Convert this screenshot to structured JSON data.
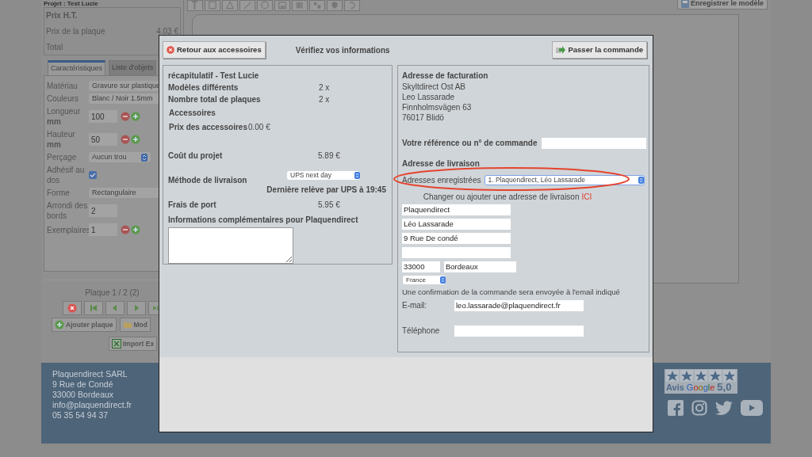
{
  "background": {
    "project_title": "Projet : Test Lucie",
    "save_button": "Enregistrer le modèle",
    "price": {
      "title": "Prix H.T.",
      "rows": [
        {
          "label": "Prix de la plaque",
          "value": "4.03 €"
        },
        {
          "label": "Total"
        }
      ]
    },
    "tabs": [
      {
        "label": "Caractéristiques",
        "selected": true
      },
      {
        "label": "Liste d'objets",
        "selected": false
      }
    ],
    "form": [
      {
        "label": "Matériau",
        "kind": "choice",
        "value": "Gravure sur plastique"
      },
      {
        "label": "Couleurs",
        "kind": "choice",
        "value": "Blanc / Noir 1.5mm"
      },
      {
        "label": "Longueur",
        "unit": "mm",
        "kind": "number",
        "value": "100",
        "stepper": true
      },
      {
        "label": "Hauteur",
        "unit": "mm",
        "kind": "number",
        "value": "50",
        "stepper": true
      },
      {
        "label": "Perçage",
        "kind": "dropdown",
        "value": "Aucun trou"
      },
      {
        "label": "Adhésif au dos",
        "kind": "checkbox",
        "checked": true
      },
      {
        "label": "Forme",
        "kind": "choice",
        "value": "Rectangulaire"
      },
      {
        "label": "Arrondi des bords",
        "kind": "number",
        "value": "2",
        "stepper": false
      },
      {
        "label": "Exemplaires",
        "kind": "number",
        "value": "1",
        "stepper": true
      }
    ],
    "pager": "Plaque 1 / 2 (2)",
    "actions": [
      {
        "label": "Ajouter plaque",
        "kind": "add"
      },
      {
        "label": "Mod",
        "kind": "folder"
      },
      {
        "label": "Import Ex",
        "kind": "excel"
      }
    ],
    "footer": [
      "Plaquendirect SARL",
      "9 Rue de Condé",
      "33000 Bordeaux",
      "info@plaquendirect.fr",
      "05 35 54 94 37"
    ],
    "rating": {
      "stars": 5,
      "label": "Avis",
      "brand": "Google",
      "score": "5,0"
    }
  },
  "modal": {
    "back_button": "Retour aux accessoires",
    "title": "Vérifiez vos informations",
    "submit_button": "Passer la commande",
    "summary": {
      "title": "récapitulatif - Test Lucie",
      "rows": [
        {
          "label": "Modèles différents",
          "value": "2 x"
        },
        {
          "label": "Nombre total de plaques",
          "value": "2 x"
        }
      ],
      "accessories_title": "Accessoires",
      "accessories_label": "Prix des accessoires",
      "accessories_value": "0.00 €",
      "cost_label": "Coût du projet",
      "cost_value": "5.89 €",
      "delivery_label": "Méthode de livraison",
      "delivery_value": "UPS next day",
      "pickup_note": "Dernière relève par UPS à 19:45",
      "shipping_label": "Frais de port",
      "shipping_value": "5.95 €",
      "info_label": "Informations complémentaires pour Plaquendirect"
    },
    "billing": {
      "title": "Adresse de facturation",
      "lines": [
        "Skyltdirect Ost AB",
        "Leo Lassarade",
        "Finnholmsvägen 63",
        "76017 Blidö"
      ],
      "reference_label": "Votre référence ou n° de commande"
    },
    "shipping": {
      "title": "Adresse de livraison",
      "saved_label": "Adresses enregistrées",
      "saved_value": "1. Plaquendirect, Léo Lassarade",
      "change_text": "Changer ou ajouter une adresse de livraison",
      "change_link": "ICI",
      "fields": [
        "Plaquendirect",
        "Léo Lassarade",
        "9 Rue De condé"
      ],
      "zip": "33000",
      "city": "Bordeaux",
      "country": "France",
      "confirmation": "Une confirmation de la commande sera envoyée à l'email indiqué",
      "email_label": "E-mail:",
      "email_value": "leo.lassarade@plaquendirect.fr",
      "phone_label": "Téléphone"
    }
  }
}
